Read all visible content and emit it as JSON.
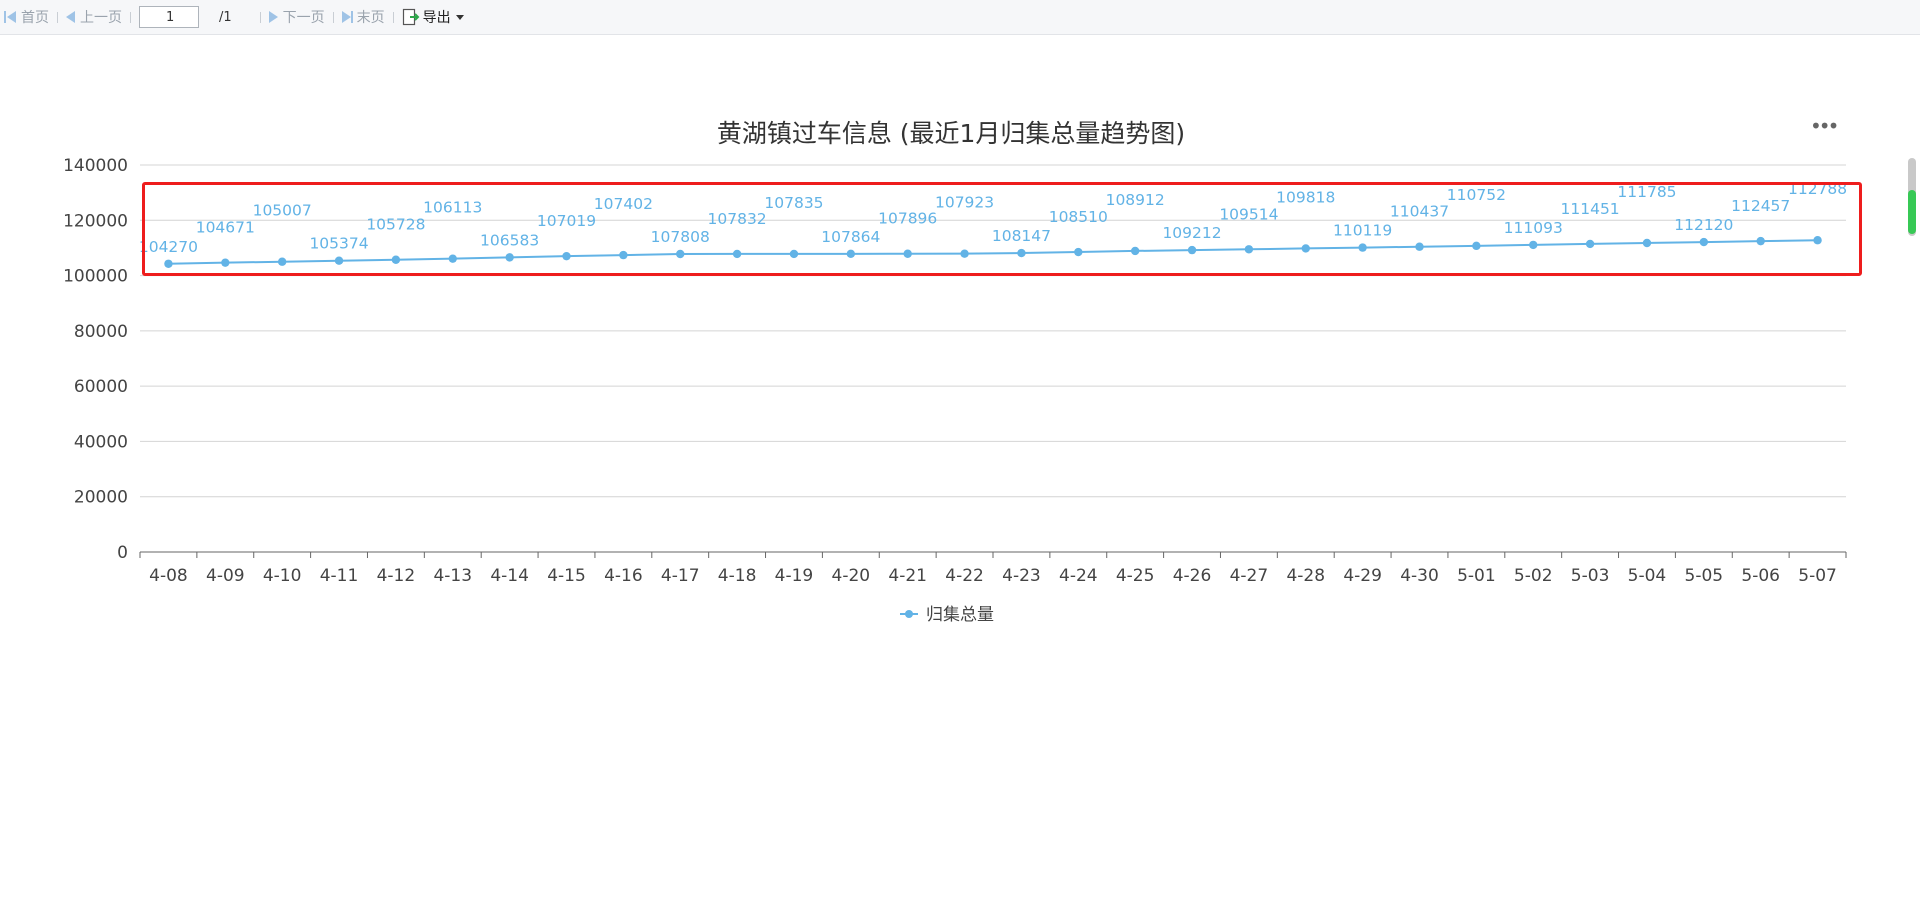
{
  "toolbar": {
    "first_label": "首页",
    "prev_label": "上一页",
    "page_value": "1",
    "page_total": "/1",
    "next_label": "下一页",
    "last_label": "末页",
    "export_label": "导出"
  },
  "chart": {
    "title": "黄湖镇过车信息 (最近1月归集总量趋势图)",
    "legend_label": "归集总量",
    "line_color": "#62b3e6",
    "highlight_color": "#ee1d1d"
  },
  "chart_data": {
    "type": "line",
    "title": "黄湖镇过车信息 (最近1月归集总量趋势图)",
    "xlabel": "",
    "ylabel": "",
    "ylim": [
      0,
      140000
    ],
    "yticks": [
      0,
      20000,
      40000,
      60000,
      80000,
      100000,
      120000,
      140000
    ],
    "grid": true,
    "legend_position": "bottom",
    "x": [
      "4-08",
      "4-09",
      "4-10",
      "4-11",
      "4-12",
      "4-13",
      "4-14",
      "4-15",
      "4-16",
      "4-17",
      "4-18",
      "4-19",
      "4-20",
      "4-21",
      "4-22",
      "4-23",
      "4-24",
      "4-25",
      "4-26",
      "4-27",
      "4-28",
      "4-29",
      "4-30",
      "5-01",
      "5-02",
      "5-03",
      "5-04",
      "5-05",
      "5-06",
      "5-07"
    ],
    "series": [
      {
        "name": "归集总量",
        "values": [
          104270,
          104671,
          105007,
          105374,
          105728,
          106113,
          106583,
          107019,
          107402,
          107808,
          107832,
          107835,
          107864,
          107896,
          107923,
          108147,
          108510,
          108912,
          109212,
          109514,
          109818,
          110119,
          110437,
          110752,
          111093,
          111451,
          111785,
          112120,
          112457,
          112788
        ]
      }
    ]
  }
}
